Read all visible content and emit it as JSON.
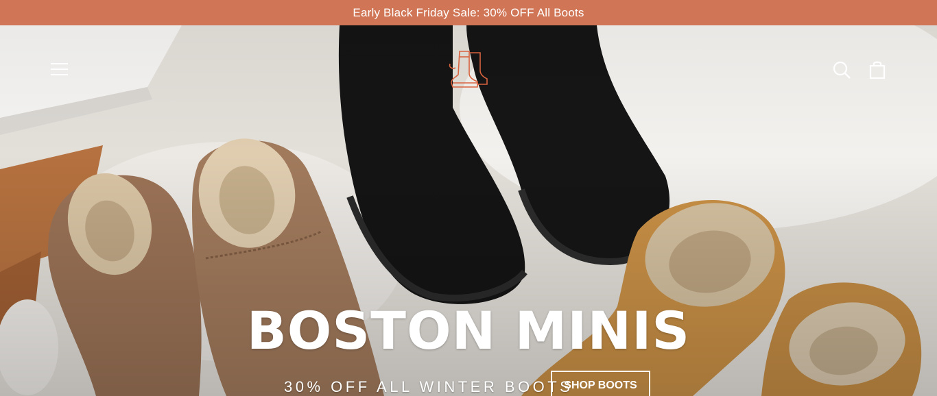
{
  "announcement": {
    "text": "Early Black Friday Sale: 30% OFF All Boots"
  },
  "header": {
    "menu_icon": "hamburger-menu-icon",
    "logo_icon": "boots-logo-icon",
    "search_icon": "search-icon",
    "cart_icon": "shopping-bag-icon"
  },
  "hero": {
    "title": "BOSTON MINIS",
    "subtitle": "30% OFF ALL WINTER BOOTS",
    "cta_label": "SHOP BOOTS"
  },
  "colors": {
    "announcement_bg": "#d07555",
    "logo_stroke": "#d8633f",
    "text_on_hero": "#ffffff"
  }
}
